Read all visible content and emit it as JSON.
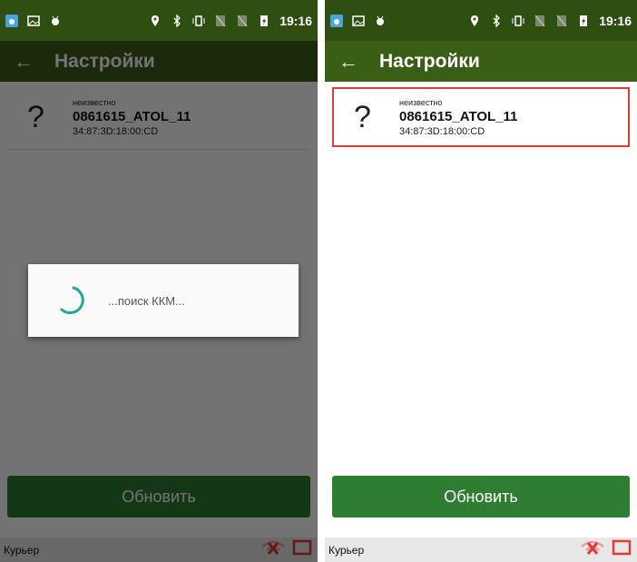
{
  "status_bar": {
    "time": "19:16"
  },
  "app_bar": {
    "title": "Настройки"
  },
  "device": {
    "icon": "?",
    "status": "неизвестно",
    "name": "0861615_ATOL_11",
    "mac": "34:87:3D:18:00:CD"
  },
  "dialog": {
    "message": "...поиск ККМ..."
  },
  "buttons": {
    "refresh": "Обновить"
  },
  "footer": {
    "label": "Курьер"
  },
  "colors": {
    "status_bar": "#2f4f12",
    "app_bar": "#3b5e17",
    "button": "#2e7d32",
    "highlight_border": "#e53935",
    "spinner": "#26a69a"
  }
}
